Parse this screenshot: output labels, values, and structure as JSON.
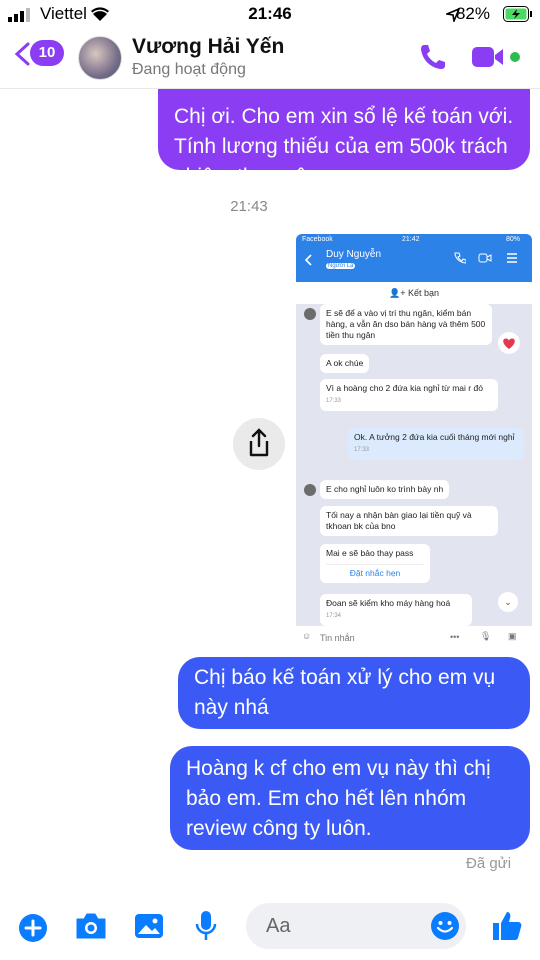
{
  "status_bar": {
    "carrier": "Viettel",
    "time": "21:46",
    "battery": "82%"
  },
  "header": {
    "back_count": "10",
    "contact_name": "Vương Hải Yến",
    "contact_status": "Đang hoạt động"
  },
  "messages": {
    "top_bubble": "Chị ơi. Cho em xin sổ lệ kế toán với. Tính lương thiếu của em 500k trách nhiệm thu ngân",
    "timestamp": "21:43",
    "bubble_1": "Chị báo kế toán xử lý cho em vụ này nhá",
    "bubble_2": "Hoàng k cf cho em vụ này thì chị bảo em. Em cho hết lên nhóm review công ty luôn.",
    "sent_label": "Đã gửi"
  },
  "embedded": {
    "status_left": "Facebook",
    "status_time": "21:42",
    "status_right": "80%",
    "name": "Duy Nguyễn",
    "sub": "Người Lạ",
    "add_friend": "Kết bạn",
    "msg1": "E sẽ để a vào vị trí thu ngân, kiểm bán hàng, a vẫn ăn dso bán hàng và thêm 500 tiền thu ngân",
    "msg2": "A ok chúe",
    "msg3": "Vì a hoàng cho 2 đứa kia nghỉ từ mai r đó",
    "msg3_time": "17:33",
    "msg4": "Ok. A tưởng 2 đứa kia cuối tháng mới nghỉ",
    "msg4_time": "17:33",
    "msg5": "E cho nghỉ luôn ko trình bày nh",
    "msg6": "Tối nay a nhận bàn giao lại tiền quỹ và tkhoan bk của bno",
    "msg7": "Mai e sẽ bảo thay pass",
    "msg7_link": "Đặt nhắc hẹn",
    "msg8": "Đoan sẽ kiểm kho máy hàng hoá",
    "msg8_time": "17:34",
    "composer_placeholder": "Tin nhắn"
  },
  "composer": {
    "placeholder": "Aa"
  },
  "colors": {
    "accent_purple": "#8a3df2",
    "accent_blue": "#3b59f5",
    "messenger_blue": "#0a7cff"
  }
}
